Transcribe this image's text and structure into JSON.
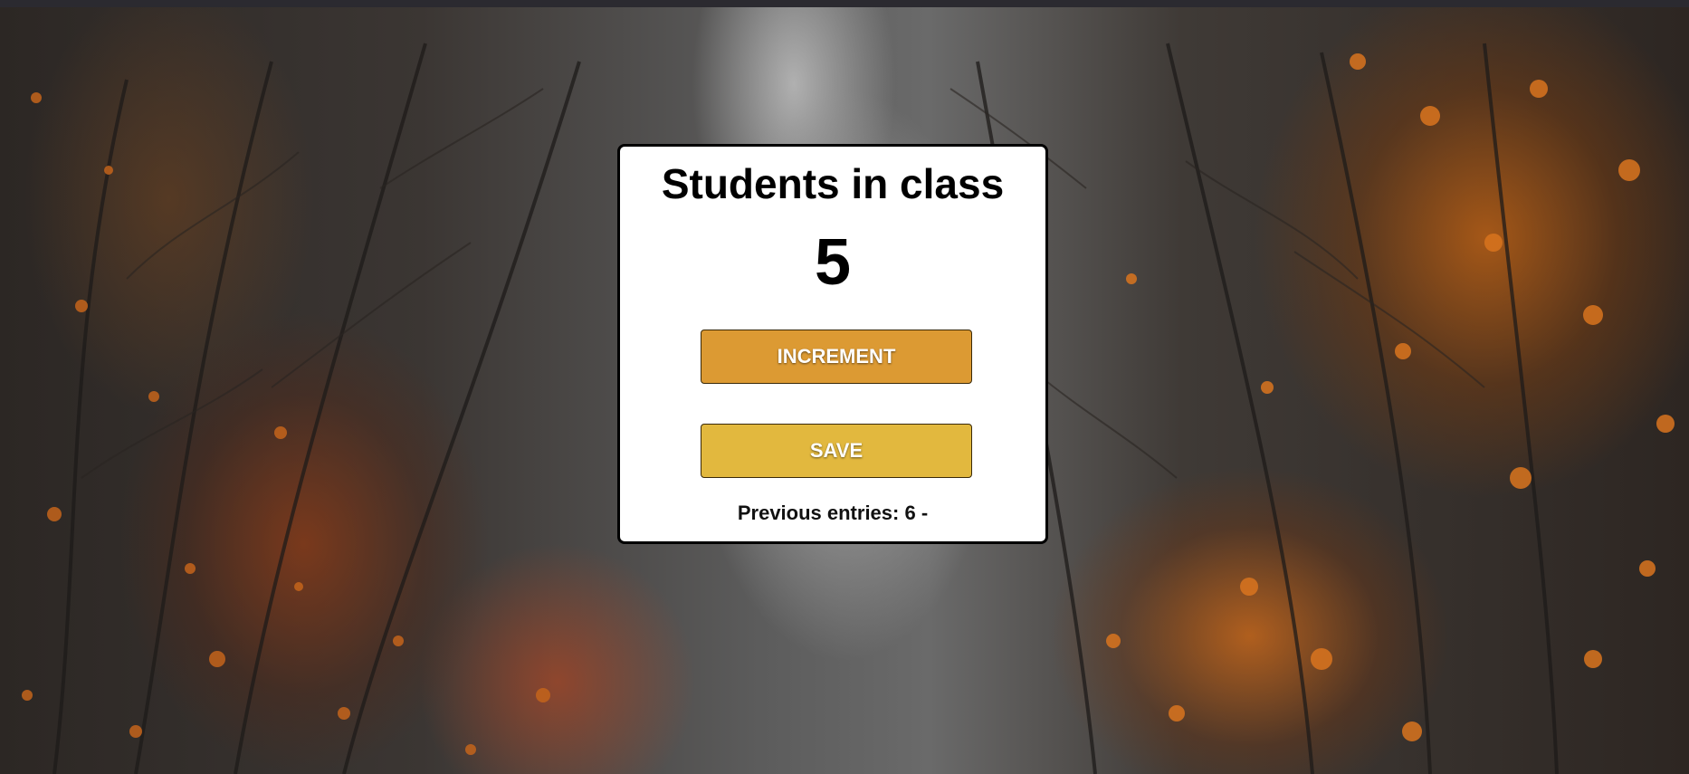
{
  "counter": {
    "title": "Students in class",
    "count": "5",
    "increment_label": "INCREMENT",
    "save_label": "SAVE",
    "previous_entries": "Previous entries: 6 -"
  },
  "colors": {
    "increment_button": "#dc9a33",
    "save_button": "#e2b83e",
    "card_background": "#ffffff",
    "card_border": "#000000"
  }
}
